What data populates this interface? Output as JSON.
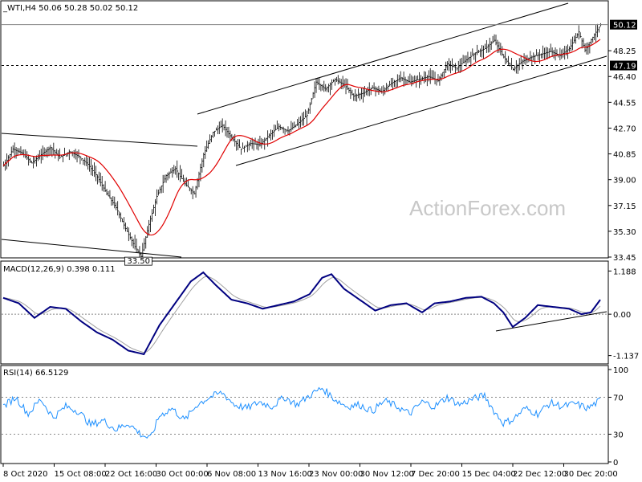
{
  "chart_data": [
    {
      "type": "candlestick",
      "panel": "price",
      "title": "_WTI,H4  50.06 50.28 50.02 50.12",
      "watermark": "ActionForex.com",
      "yticks": [
        "50.12",
        "48.25",
        "47.19",
        "46.40",
        "44.55",
        "42.70",
        "40.85",
        "39.00",
        "37.15",
        "35.30",
        "33.45"
      ],
      "ylim": [
        33.45,
        51.6
      ],
      "last_price": "50.12",
      "level_line": "47.19",
      "low_label": "33.50",
      "low_value": 33.5,
      "colors": {
        "bars": "#000000",
        "ma": "#e00000",
        "channel": "#000000",
        "price_tag": "#000000",
        "price_tag_text": "#ffffff"
      },
      "price_series_approx": [
        [
          0,
          40.0
        ],
        [
          6,
          41.2
        ],
        [
          12,
          40.9
        ],
        [
          18,
          40.2
        ],
        [
          24,
          40.8
        ],
        [
          30,
          41.3
        ],
        [
          36,
          40.6
        ],
        [
          42,
          41.0
        ],
        [
          48,
          40.7
        ],
        [
          54,
          40.1
        ],
        [
          60,
          39.2
        ],
        [
          66,
          38.0
        ],
        [
          72,
          37.0
        ],
        [
          78,
          35.5
        ],
        [
          84,
          34.2
        ],
        [
          88,
          33.5
        ],
        [
          93,
          35.8
        ],
        [
          98,
          37.8
        ],
        [
          104,
          39.3
        ],
        [
          110,
          39.8
        ],
        [
          116,
          38.7
        ],
        [
          122,
          38.0
        ],
        [
          128,
          40.8
        ],
        [
          134,
          42.4
        ],
        [
          140,
          42.9
        ],
        [
          146,
          42.0
        ],
        [
          152,
          41.2
        ],
        [
          158,
          41.6
        ],
        [
          164,
          41.5
        ],
        [
          170,
          42.2
        ],
        [
          176,
          42.8
        ],
        [
          182,
          42.5
        ],
        [
          188,
          43.0
        ],
        [
          194,
          43.6
        ],
        [
          200,
          46.0
        ],
        [
          206,
          45.5
        ],
        [
          212,
          46.2
        ],
        [
          218,
          45.8
        ],
        [
          224,
          45.0
        ],
        [
          230,
          45.2
        ],
        [
          236,
          45.6
        ],
        [
          242,
          45.3
        ],
        [
          248,
          45.9
        ],
        [
          254,
          46.3
        ],
        [
          260,
          46.0
        ],
        [
          266,
          46.2
        ],
        [
          272,
          46.4
        ],
        [
          278,
          46.1
        ],
        [
          284,
          47.3
        ],
        [
          290,
          47.0
        ],
        [
          296,
          47.6
        ],
        [
          302,
          48.1
        ],
        [
          308,
          48.4
        ],
        [
          314,
          49.0
        ],
        [
          320,
          47.8
        ],
        [
          326,
          46.9
        ],
        [
          332,
          47.5
        ],
        [
          338,
          47.8
        ],
        [
          344,
          48.0
        ],
        [
          350,
          48.2
        ],
        [
          356,
          47.9
        ],
        [
          362,
          48.4
        ],
        [
          368,
          49.6
        ],
        [
          372,
          48.3
        ],
        [
          378,
          49.4
        ],
        [
          382,
          50.12
        ]
      ]
    },
    {
      "type": "line",
      "panel": "macd",
      "title": "MACD(12,26,9) 0.398 0.111",
      "yticks": [
        "1.188",
        "0.00",
        "-1.137"
      ],
      "ylim": [
        -1.3,
        1.35
      ],
      "colors": {
        "macd": "#000080",
        "signal": "#a0a0a0"
      },
      "values_approx": [
        [
          0,
          0.45
        ],
        [
          10,
          0.3
        ],
        [
          20,
          -0.1
        ],
        [
          30,
          0.2
        ],
        [
          40,
          0.15
        ],
        [
          50,
          -0.2
        ],
        [
          60,
          -0.5
        ],
        [
          70,
          -0.7
        ],
        [
          80,
          -1.0
        ],
        [
          90,
          -1.1
        ],
        [
          100,
          -0.3
        ],
        [
          110,
          0.3
        ],
        [
          120,
          0.9
        ],
        [
          128,
          1.15
        ],
        [
          136,
          0.8
        ],
        [
          146,
          0.4
        ],
        [
          156,
          0.3
        ],
        [
          166,
          0.15
        ],
        [
          176,
          0.25
        ],
        [
          186,
          0.35
        ],
        [
          196,
          0.55
        ],
        [
          204,
          1.0
        ],
        [
          210,
          1.1
        ],
        [
          218,
          0.7
        ],
        [
          228,
          0.4
        ],
        [
          238,
          0.1
        ],
        [
          248,
          0.25
        ],
        [
          258,
          0.3
        ],
        [
          268,
          0.05
        ],
        [
          276,
          0.3
        ],
        [
          286,
          0.35
        ],
        [
          296,
          0.45
        ],
        [
          306,
          0.48
        ],
        [
          314,
          0.3
        ],
        [
          320,
          0.05
        ],
        [
          326,
          -0.35
        ],
        [
          334,
          -0.1
        ],
        [
          342,
          0.25
        ],
        [
          352,
          0.2
        ],
        [
          362,
          0.15
        ],
        [
          370,
          0.0
        ],
        [
          376,
          0.05
        ],
        [
          382,
          0.398
        ]
      ]
    },
    {
      "type": "line",
      "panel": "rsi",
      "title": "RSI(14) 66.5129",
      "yticks": [
        "100",
        "70",
        "30",
        "0"
      ],
      "ylim": [
        0,
        100
      ],
      "levels": [
        70,
        30
      ],
      "colors": {
        "rsi": "#1e90ff"
      },
      "values_approx": [
        [
          0,
          60
        ],
        [
          8,
          70
        ],
        [
          16,
          52
        ],
        [
          24,
          68
        ],
        [
          32,
          48
        ],
        [
          40,
          60
        ],
        [
          48,
          55
        ],
        [
          56,
          40
        ],
        [
          64,
          45
        ],
        [
          72,
          35
        ],
        [
          80,
          42
        ],
        [
          88,
          30
        ],
        [
          94,
          25
        ],
        [
          100,
          50
        ],
        [
          108,
          58
        ],
        [
          116,
          45
        ],
        [
          124,
          62
        ],
        [
          132,
          70
        ],
        [
          140,
          75
        ],
        [
          148,
          62
        ],
        [
          156,
          58
        ],
        [
          164,
          65
        ],
        [
          172,
          60
        ],
        [
          180,
          70
        ],
        [
          188,
          62
        ],
        [
          196,
          72
        ],
        [
          204,
          80
        ],
        [
          212,
          68
        ],
        [
          220,
          60
        ],
        [
          228,
          62
        ],
        [
          236,
          55
        ],
        [
          244,
          66
        ],
        [
          252,
          60
        ],
        [
          260,
          52
        ],
        [
          268,
          65
        ],
        [
          276,
          60
        ],
        [
          284,
          70
        ],
        [
          292,
          62
        ],
        [
          300,
          68
        ],
        [
          308,
          72
        ],
        [
          314,
          55
        ],
        [
          320,
          42
        ],
        [
          326,
          46
        ],
        [
          334,
          58
        ],
        [
          342,
          52
        ],
        [
          350,
          64
        ],
        [
          358,
          60
        ],
        [
          366,
          63
        ],
        [
          374,
          58
        ],
        [
          382,
          66.5
        ]
      ]
    }
  ],
  "xaxis": {
    "labels": [
      "8 Oct 2020",
      "15 Oct 08:00",
      "22 Oct 16:00",
      "30 Oct 00:00",
      "6 Nov 08:00",
      "13 Nov 16:00",
      "23 Nov 00:00",
      "30 Nov 12:00",
      "7 Dec 20:00",
      "15 Dec 04:00",
      "22 Dec 12:00",
      "30 Dec 20:00"
    ]
  }
}
